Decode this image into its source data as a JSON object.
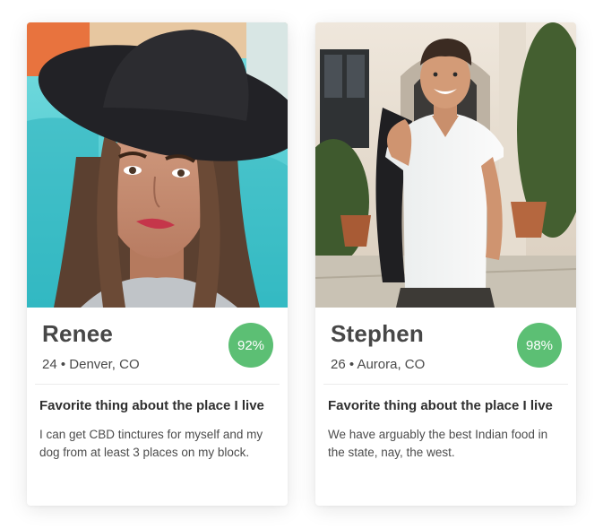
{
  "colors": {
    "accent_green": "#5cbf74",
    "card_background": "#ffffff",
    "text_dark": "#474747"
  },
  "profiles": [
    {
      "name": "Renee",
      "age_location": "24 • Denver, CO",
      "match_score": "92%",
      "question": "Favorite thing about the place I live",
      "answer": "I can get CBD tinctures for myself and my dog from at least 3 places on my block."
    },
    {
      "name": "Stephen",
      "age_location": "26 • Aurora, CO",
      "match_score": "98%",
      "question": "Favorite thing about the place I live",
      "answer": "We have arguably the best Indian food in the state, nay, the west."
    }
  ]
}
